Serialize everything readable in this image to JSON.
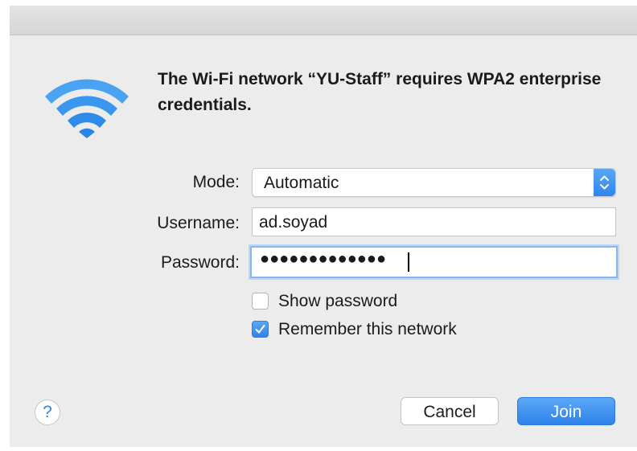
{
  "dialog": {
    "icon": "wifi-icon",
    "message": "The Wi-Fi network “YU-Staff” requires WPA2 enterprise credentials.",
    "accent_color": "#2f84ea"
  },
  "form": {
    "mode_label": "Mode:",
    "mode_value": "Automatic",
    "username_label": "Username:",
    "username_value": "ad.soyad",
    "password_label": "Password:",
    "password_masked": "●●●●●●●●●●●●●",
    "show_password": {
      "label": "Show password",
      "checked": false
    },
    "remember_network": {
      "label": "Remember this network",
      "checked": true
    }
  },
  "buttons": {
    "help": "?",
    "cancel": "Cancel",
    "join": "Join"
  }
}
